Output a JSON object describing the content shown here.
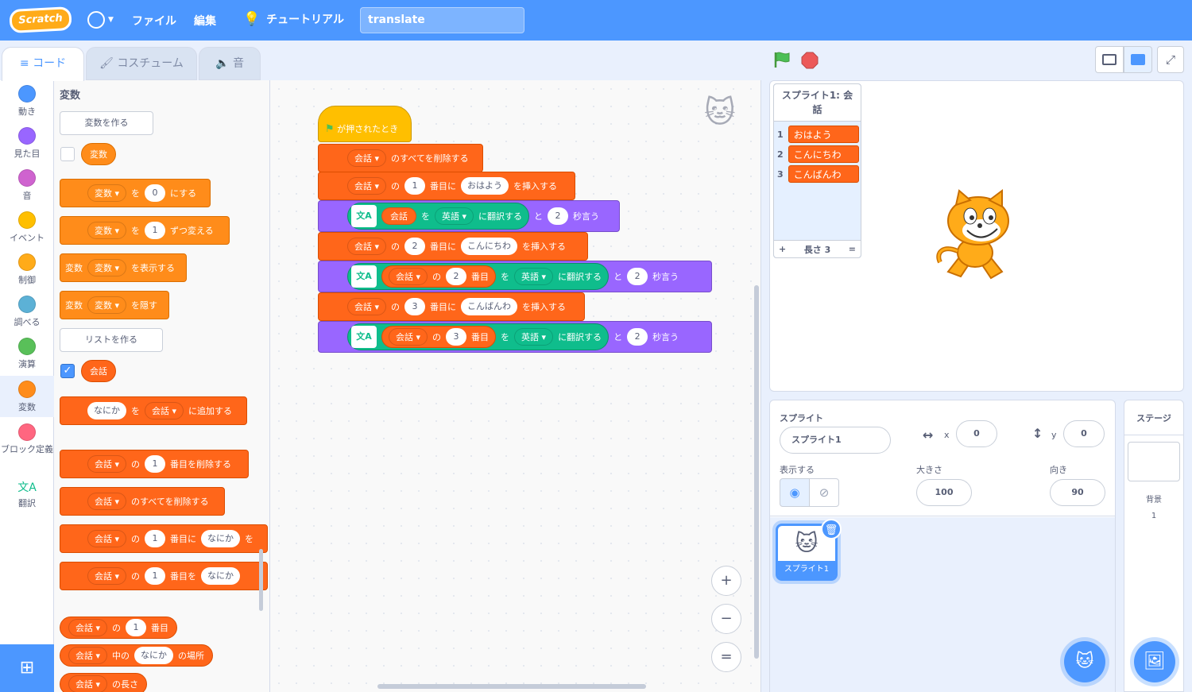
{
  "menubar": {
    "logo": "Scratch",
    "file": "ファイル",
    "edit": "編集",
    "tutorials": "チュートリアル",
    "project_title": "translate"
  },
  "tabs": {
    "code": "コード",
    "costumes": "コスチューム",
    "sounds": "音"
  },
  "categories": [
    {
      "label": "動き",
      "color": "#4c97ff"
    },
    {
      "label": "見た目",
      "color": "#9966ff"
    },
    {
      "label": "音",
      "color": "#cf63cf"
    },
    {
      "label": "イベント",
      "color": "#ffbf00"
    },
    {
      "label": "制御",
      "color": "#ffab19"
    },
    {
      "label": "調べる",
      "color": "#5cb1d6"
    },
    {
      "label": "演算",
      "color": "#59c059"
    },
    {
      "label": "変数",
      "color": "#ff8c1a"
    },
    {
      "label": "ブロック定義",
      "color": "#ff6680"
    },
    {
      "label": "翻訳",
      "color": "#0fbd8c"
    }
  ],
  "palette": {
    "heading": "変数",
    "make_variable": "変数を作る",
    "variable_name": "変数",
    "set_var": {
      "var": "変数",
      "to": "を",
      "value": "0",
      "suffix": "にする"
    },
    "change_var": {
      "var": "変数",
      "to": "を",
      "value": "1",
      "suffix": "ずつ変える"
    },
    "show_var": {
      "prefix": "変数",
      "var": "変数",
      "suffix": "を表示する"
    },
    "hide_var": {
      "prefix": "変数",
      "var": "変数",
      "suffix": "を隠す"
    },
    "make_list": "リストを作る",
    "list_name": "会話",
    "add_to_list": {
      "item": "なにか",
      "to": "を",
      "list": "会話",
      "suffix": "に追加する"
    },
    "delete_item": {
      "list": "会話",
      "of": "の",
      "index": "1",
      "suffix": "番目を削除する"
    },
    "delete_all": {
      "list": "会話",
      "suffix": "のすべてを削除する"
    },
    "insert_item": {
      "list": "会話",
      "of": "の",
      "index": "1",
      "mid": "番目に",
      "item": "なにか",
      "suffix": "を"
    },
    "replace_item": {
      "list": "会話",
      "of": "の",
      "index": "1",
      "mid": "番目を",
      "item": "なにか"
    },
    "item_of": {
      "list": "会話",
      "of": "の",
      "index": "1",
      "suffix": "番目"
    },
    "item_number": {
      "list": "会話",
      "mid": "中の",
      "item": "なにか",
      "suffix": "の場所"
    },
    "length_of": {
      "list": "会話",
      "suffix": "の長さ"
    }
  },
  "script": {
    "hat": "が押されたとき",
    "b1": {
      "list": "会話",
      "suffix": "のすべてを削除する"
    },
    "b2": {
      "list": "会話",
      "of": "の",
      "index": "1",
      "mid": "番目に",
      "item": "おはよう",
      "suffix": "を挿入する"
    },
    "b3": {
      "list": "会話",
      "to": "を",
      "lang": "英語",
      "translate": "に翻訳する",
      "and": "と",
      "secs": "2",
      "say": "秒言う"
    },
    "b4": {
      "list": "会話",
      "of": "の",
      "index": "2",
      "mid": "番目に",
      "item": "こんにちわ",
      "suffix": "を挿入する"
    },
    "b5": {
      "list": "会話",
      "of": "の",
      "index": "2",
      "item_sfx": "番目",
      "to": "を",
      "lang": "英語",
      "translate": "に翻訳する",
      "and": "と",
      "secs": "2",
      "say": "秒言う"
    },
    "b6": {
      "list": "会話",
      "of": "の",
      "index": "3",
      "mid": "番目に",
      "item": "こんばんわ",
      "suffix": "を挿入する"
    },
    "b7": {
      "list": "会話",
      "of": "の",
      "index": "3",
      "item_sfx": "番目",
      "to": "を",
      "lang": "英語",
      "translate": "に翻訳する",
      "and": "と",
      "secs": "2",
      "say": "秒言う"
    }
  },
  "list_monitor": {
    "title": "スプライト1: 会話",
    "items": [
      {
        "index": "1",
        "value": "おはよう"
      },
      {
        "index": "2",
        "value": "こんにちわ"
      },
      {
        "index": "3",
        "value": "こんばんわ"
      }
    ],
    "add": "+",
    "length": "長さ 3",
    "resize": "="
  },
  "sprite_info": {
    "sprite_label": "スプライト",
    "sprite_name": "スプライト1",
    "x_label": "x",
    "x": "0",
    "y_label": "y",
    "y": "0",
    "show_label": "表示する",
    "size_label": "大きさ",
    "size": "100",
    "direction_label": "向き",
    "direction": "90"
  },
  "sprite_list": [
    {
      "name": "スプライト1"
    }
  ],
  "stage_pane": {
    "title": "ステージ",
    "backdrops_label": "背景",
    "backdrops_count": "1"
  },
  "zoom": {
    "in": "+",
    "out": "−",
    "reset": "="
  }
}
